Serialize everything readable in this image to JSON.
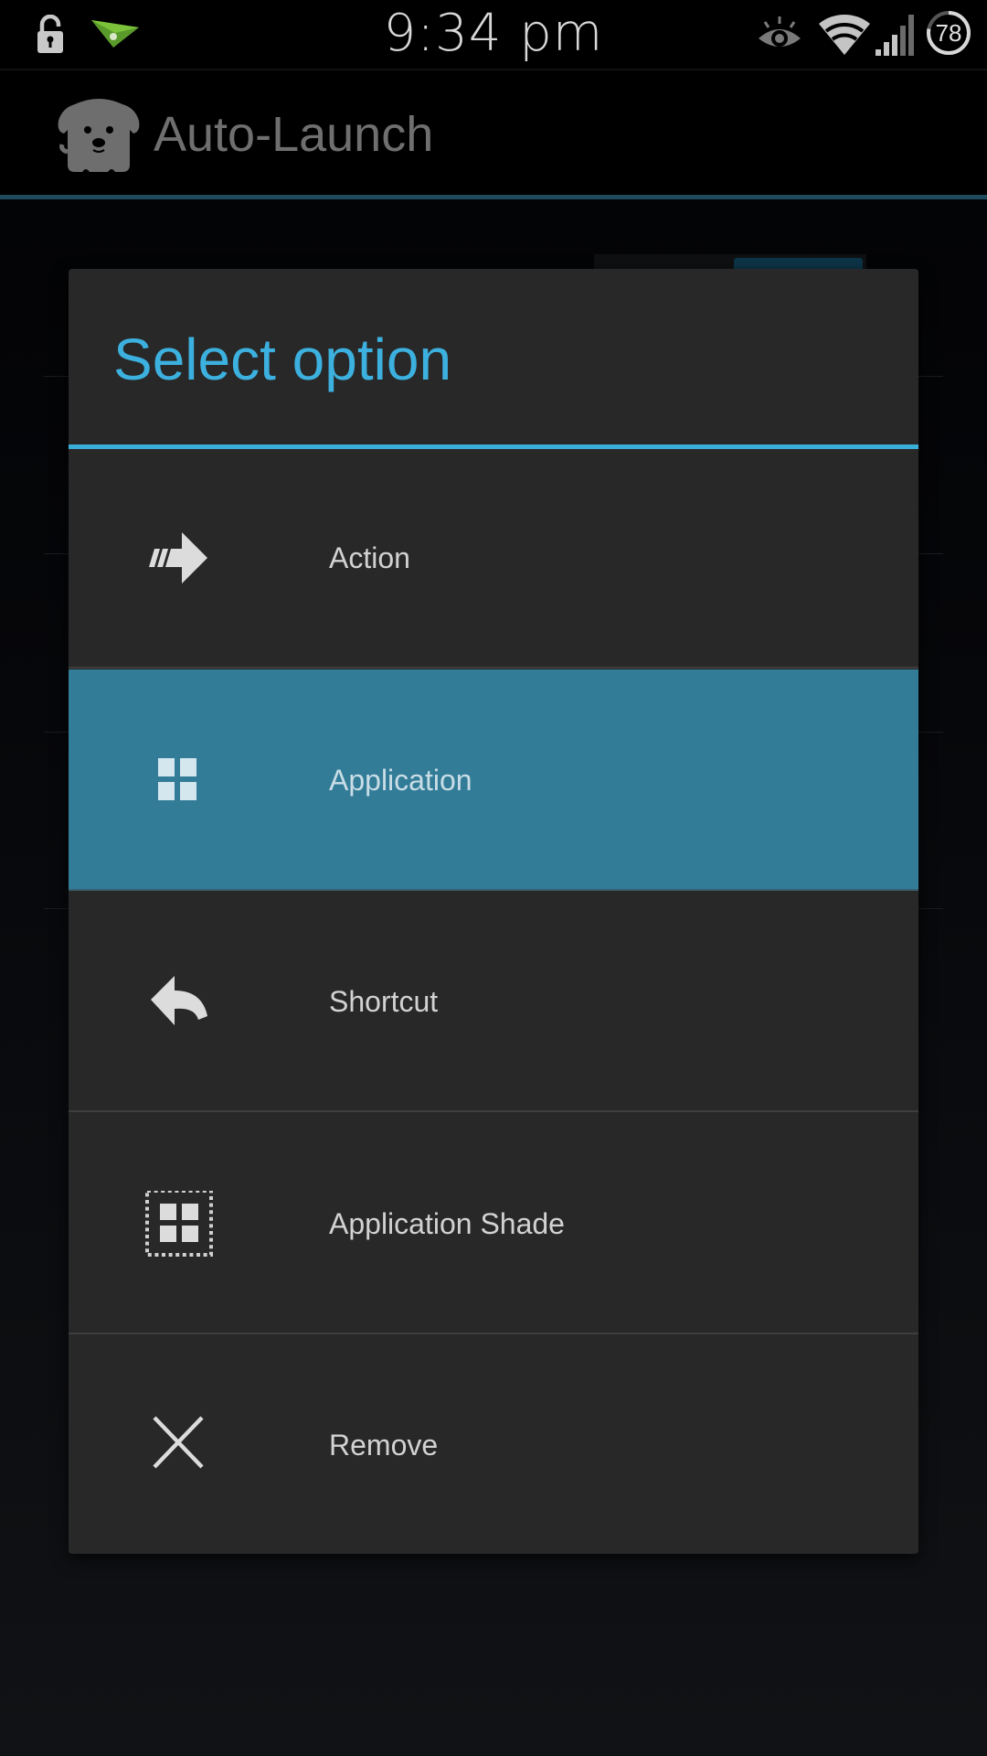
{
  "status_bar": {
    "time": "9:34 pm",
    "battery_level": "78",
    "left_icons": [
      "unlock-icon",
      "airdroid-notification-icon"
    ],
    "right_icons": [
      "eye-smart-stay-icon",
      "wifi-icon",
      "signal-icon",
      "battery-icon"
    ]
  },
  "app_bar": {
    "title": "Auto-Launch",
    "logo_icon": "dog-logo-icon"
  },
  "dialog": {
    "title": "Select option",
    "options": [
      {
        "label": "Action",
        "icon": "action-arrow-icon",
        "selected": false
      },
      {
        "label": "Application",
        "icon": "application-grid-icon",
        "selected": true
      },
      {
        "label": "Shortcut",
        "icon": "shortcut-reply-icon",
        "selected": false
      },
      {
        "label": "Application Shade",
        "icon": "application-shade-icon",
        "selected": false
      },
      {
        "label": "Remove",
        "icon": "remove-x-icon",
        "selected": false
      }
    ]
  },
  "colors": {
    "accent": "#3aaed9",
    "selected_row": "#327c98",
    "dialog_bg": "#282828"
  }
}
